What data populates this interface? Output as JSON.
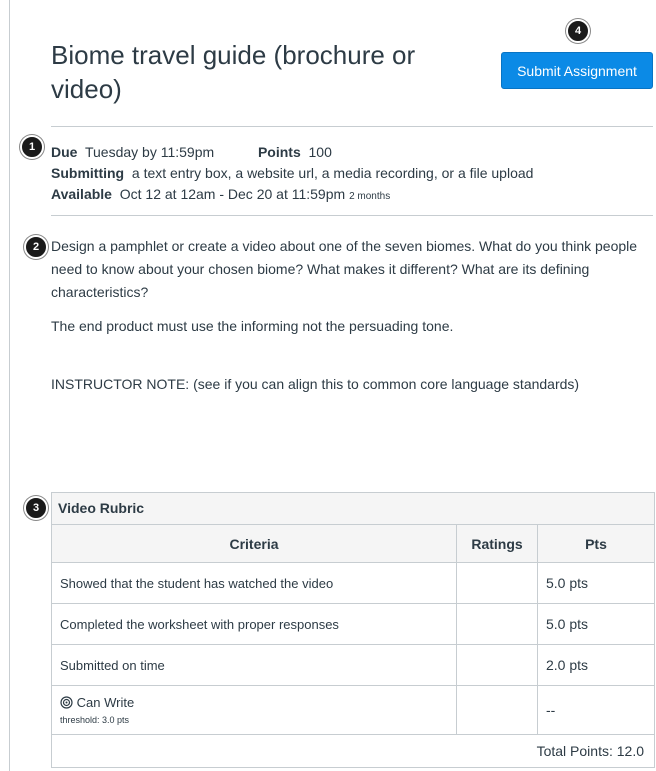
{
  "assignment": {
    "title": "Biome travel guide (brochure or video)",
    "submit_label": "Submit Assignment"
  },
  "callouts": [
    "1",
    "2",
    "3",
    "4"
  ],
  "details": {
    "due_label": "Due",
    "due_value": "Tuesday by 11:59pm",
    "points_label": "Points",
    "points_value": "100",
    "submitting_label": "Submitting",
    "submitting_value": "a text entry box, a website url, a media recording, or a file upload",
    "available_label": "Available",
    "available_value": "Oct 12 at 12am - Dec 20 at 11:59pm",
    "available_duration": "2 months"
  },
  "description": {
    "p1": "Design a pamphlet or create a video about one of the seven biomes. What do you think people need to know about your chosen biome?  What makes it different? What are its defining characteristics?",
    "p2": "The end product must use the informing not the persuading tone.",
    "p3": "INSTRUCTOR NOTE: (see if you can align this to common core language standards)"
  },
  "rubric": {
    "title": "Video Rubric",
    "headers": [
      "Criteria",
      "Ratings",
      "Pts"
    ],
    "rows": [
      {
        "criteria": "Showed that the student has watched the video",
        "ratings": "",
        "pts": "5.0 pts"
      },
      {
        "criteria": "Completed the worksheet with proper responses",
        "ratings": "",
        "pts": "5.0 pts"
      },
      {
        "criteria": "Submitted on time",
        "ratings": "",
        "pts": "2.0 pts"
      }
    ],
    "outcome": {
      "icon": "target-icon",
      "name": "Can Write",
      "threshold": "threshold: 3.0 pts",
      "pts": "--"
    },
    "total": "Total Points: 12.0"
  }
}
